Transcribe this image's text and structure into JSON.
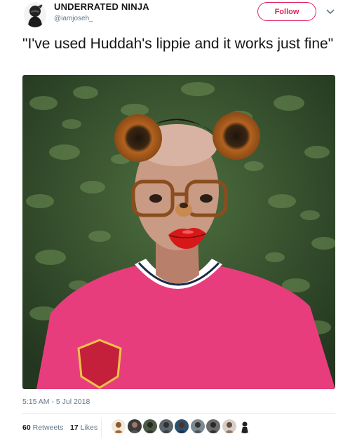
{
  "user": {
    "display_name": "UNDERRATED NINJA",
    "handle": "@iamjoseh_"
  },
  "header": {
    "follow_label": "Follow"
  },
  "tweet": {
    "text": "\"I've used Huddah's lippie and it works just fine\"",
    "timestamp": "5:15 AM - 5 Jul 2018"
  },
  "stats": {
    "retweets_count": "60",
    "retweets_label": "Retweets",
    "likes_count": "17",
    "likes_label": "Likes"
  },
  "colors": {
    "accent": "#e0245e",
    "secondary_text": "#657786",
    "divider": "#e6ecf0"
  },
  "icons": {
    "caret": "chevron-down-icon"
  }
}
